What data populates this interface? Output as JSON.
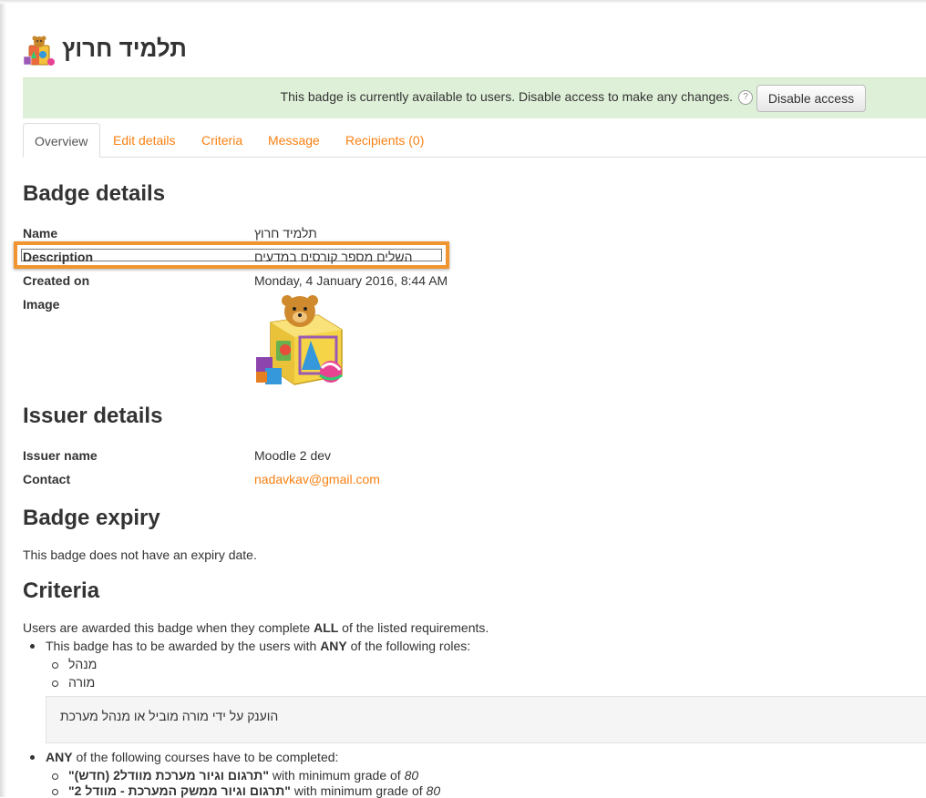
{
  "header": {
    "title": "תלמיד חרוץ",
    "icon": "badge-gift-cube-icon"
  },
  "alert": {
    "message": "This badge is currently available to users. Disable access to make any changes.",
    "help_glyph": "?",
    "disable_button": "Disable access",
    "background": "#dff0d8"
  },
  "tabs": [
    {
      "label": "Overview",
      "active": true
    },
    {
      "label": "Edit details",
      "active": false
    },
    {
      "label": "Criteria",
      "active": false
    },
    {
      "label": "Message",
      "active": false
    },
    {
      "label": "Recipients (0)",
      "active": false
    }
  ],
  "badge_details": {
    "heading": "Badge details",
    "name_label": "Name",
    "name_value": "תלמיד חרוץ",
    "description_label": "Description",
    "description_value": "השלים מספר קורסים במדעים",
    "created_label": "Created on",
    "created_value": "Monday, 4 January 2016, 8:44 AM",
    "image_label": "Image"
  },
  "issuer_details": {
    "heading": "Issuer details",
    "issuer_label": "Issuer name",
    "issuer_value": "Moodle 2 dev",
    "contact_label": "Contact",
    "contact_value": "nadavkav@gmail.com"
  },
  "expiry": {
    "heading": "Badge expiry",
    "text": "This badge does not have an expiry date."
  },
  "criteria": {
    "heading": "Criteria",
    "intro_before": "Users are awarded this badge when they complete ",
    "intro_bold": "ALL",
    "intro_after": " of the listed requirements.",
    "roles_before": "This badge has to be awarded by the users with ",
    "roles_bold": "ANY",
    "roles_after": " of the following roles:",
    "roles": [
      "מנהל",
      "מורה"
    ],
    "note": "הוענק על ידי מורה מוביל או מנהל מערכת",
    "courses_bold": "ANY",
    "courses_after": " of the following courses have to be completed:",
    "courses": [
      {
        "name": "\"תרגום וגיור מערכת מוודל2 (חדש)\"",
        "with": " with minimum grade of ",
        "grade": "80"
      },
      {
        "name": "\"תרגום וגיור ממשק המערכת - מוודל 2\"",
        "with": " with minimum grade of ",
        "grade": "80"
      }
    ]
  },
  "colors": {
    "link": "#f98012",
    "highlight": "#f0952f",
    "text": "#333333"
  }
}
